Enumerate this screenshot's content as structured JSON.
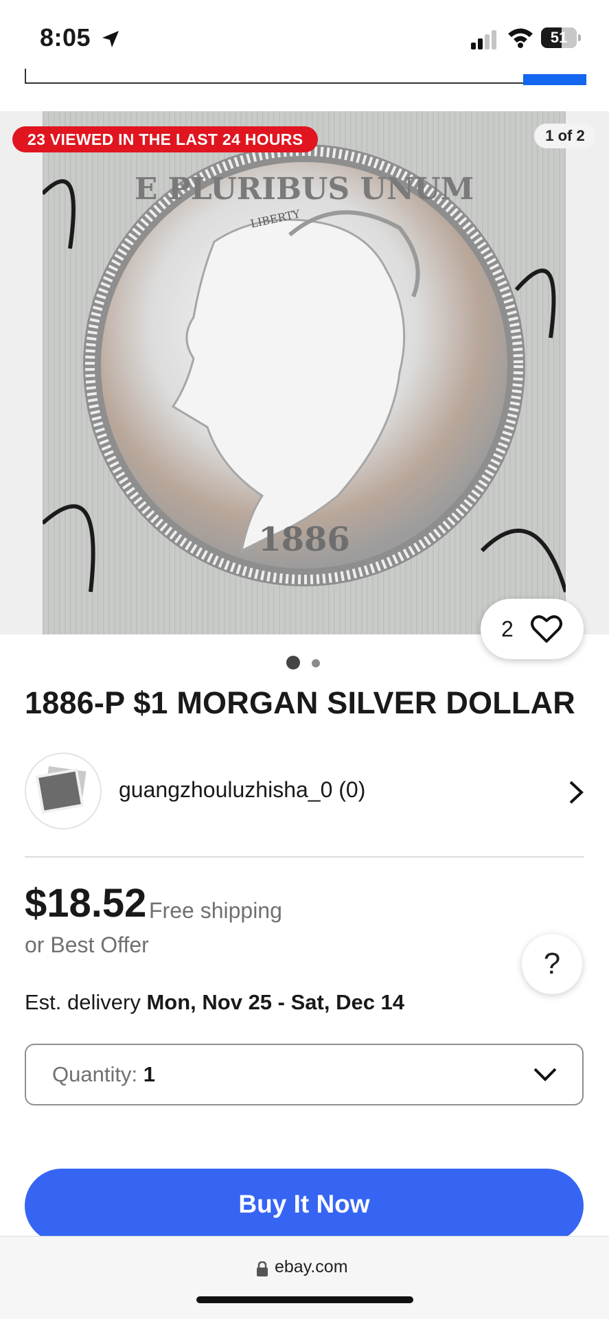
{
  "status_bar": {
    "time": "8:05",
    "battery": "51"
  },
  "hero": {
    "viewed_badge": "23 VIEWED IN THE LAST 24 HOURS",
    "image_counter": "1 of 2",
    "watch_count": "2",
    "coin": {
      "year": "1886",
      "legend": "E PLURIBUS UNUM",
      "cap_text": "LIBERTY"
    }
  },
  "listing": {
    "title": "1886-P $1 MORGAN SILVER DOLLAR",
    "seller": "guangzhouluzhisha_0 (0)",
    "price": "$18.52",
    "shipping": "Free shipping",
    "best_offer": "or Best Offer",
    "delivery_prefix": "Est. delivery",
    "delivery_dates": "Mon, Nov 25 - Sat, Dec 14",
    "quantity_label": "Quantity:",
    "quantity_value": "1",
    "buy_button": "Buy It Now"
  },
  "help_label": "?",
  "browser": {
    "url": "ebay.com"
  },
  "colors": {
    "accent": "#3665f3",
    "badge": "#e0151f",
    "search_button": "#1266ef"
  },
  "icons": [
    "location-arrow-icon",
    "cellular-signal-icon",
    "wifi-icon",
    "battery-icon",
    "heart-icon",
    "chevron-right-icon",
    "chevron-down-icon",
    "lock-icon",
    "photo-placeholder-icon"
  ]
}
